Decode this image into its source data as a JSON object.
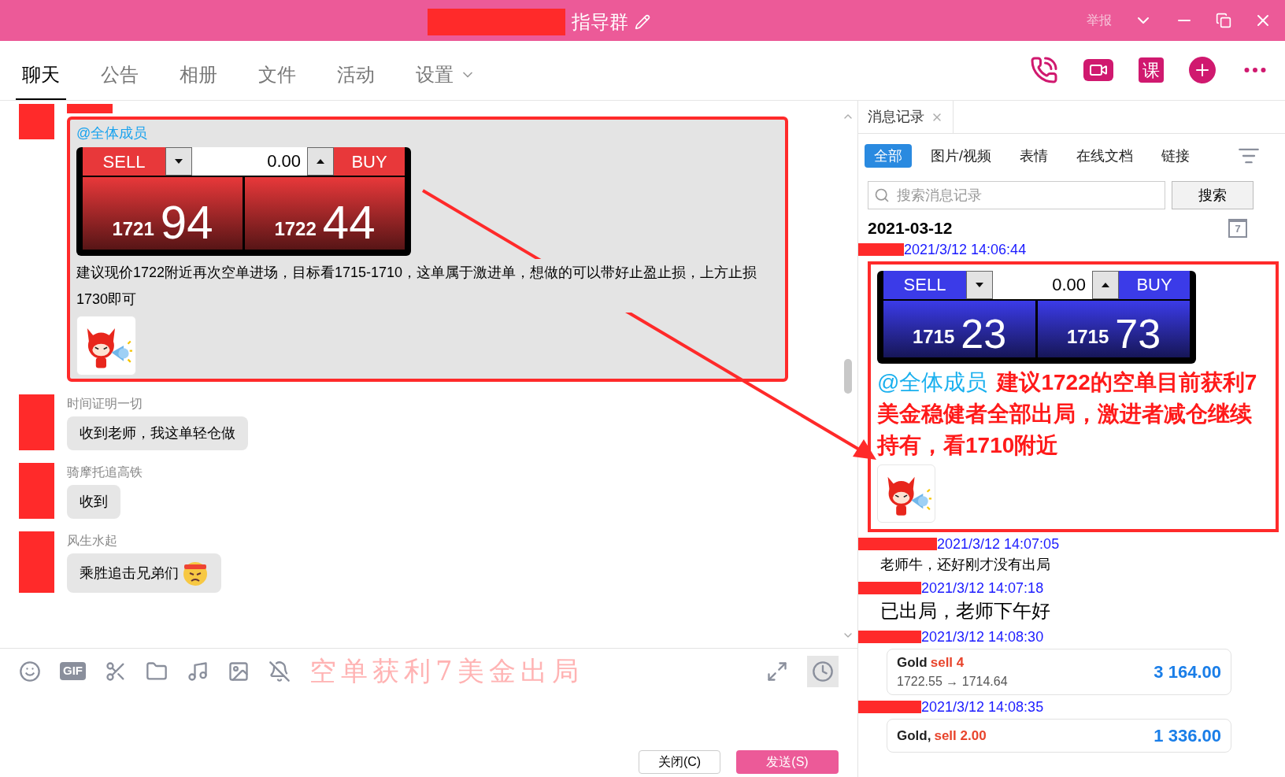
{
  "window": {
    "title": "指导群",
    "report": "举报"
  },
  "tabs": [
    {
      "label": "聊天",
      "selected": true,
      "dropdown": false
    },
    {
      "label": "公告",
      "selected": false,
      "dropdown": false
    },
    {
      "label": "相册",
      "selected": false,
      "dropdown": false
    },
    {
      "label": "文件",
      "selected": false,
      "dropdown": false
    },
    {
      "label": "活动",
      "selected": false,
      "dropdown": false
    },
    {
      "label": "设置",
      "selected": false,
      "dropdown": true
    }
  ],
  "toolbar": {
    "course_label": "课"
  },
  "chat": {
    "messages": [
      {
        "kind": "trade",
        "mention": "@全体成员",
        "widget": {
          "color": "#e8383a",
          "sell": "SELL",
          "lots": "0.00",
          "buy": "BUY",
          "bid_big": "1721",
          "bid_small": "94",
          "ask_big": "1722",
          "ask_small": "44"
        },
        "text": "建议现价1722附近再次空单进场，目标看1715-1710，这单属于激进单，想做的可以带好止盈止损，上方止损1730即可",
        "sticker": true,
        "highlighted": true
      },
      {
        "kind": "text",
        "sender": "时间证明一切",
        "text": "收到老师，我这单轻仓做",
        "emoji": false
      },
      {
        "kind": "text",
        "sender": "骑摩托追高铁",
        "text": "收到",
        "emoji": false
      },
      {
        "kind": "text",
        "sender": "风生水起",
        "text": "乘胜追击兄弟们",
        "emoji": true
      }
    ]
  },
  "composer": {
    "gif_label": "GIF",
    "overlay_caption": "空单获利7美金出局",
    "buttons": [
      {
        "label": "关闭(C)",
        "kind": "secondary"
      },
      {
        "label": "发送(S)",
        "kind": "primary"
      }
    ]
  },
  "history": {
    "tab": "消息记录",
    "filters": [
      {
        "label": "全部",
        "selected": true
      },
      {
        "label": "图片/视频",
        "selected": false
      },
      {
        "label": "表情",
        "selected": false
      },
      {
        "label": "在线文档",
        "selected": false
      },
      {
        "label": "链接",
        "selected": false
      }
    ],
    "search": {
      "placeholder": "搜索消息记录",
      "button": "搜索"
    },
    "date": "2021-03-12",
    "calendar_day": "7",
    "entries": [
      {
        "kind": "rich",
        "time": "2021/3/12 14:06:44",
        "widget": {
          "color": "#3b3be8",
          "sell": "SELL",
          "lots": "0.00",
          "buy": "BUY",
          "bid_big": "1715",
          "bid_small": "23",
          "ask_big": "1715",
          "ask_small": "73"
        },
        "mention": "@全体成员",
        "text": "建议1722的空单目前获利7美金稳健者全部出局，激进者减仓继续持有，看1710附近",
        "sticker": true,
        "highlighted": true
      },
      {
        "kind": "text",
        "time": "2021/3/12 14:07:05",
        "text": "老师牛，还好刚才没有出局",
        "large": false
      },
      {
        "kind": "text",
        "time": "2021/3/12 14:07:18",
        "text": "已出局，老师下午好",
        "large": true
      },
      {
        "kind": "trade_card",
        "time": "2021/3/12 14:08:30",
        "symbol": "Gold",
        "side": "sell 4",
        "prices": "1722.55 → 1714.64",
        "profit": "3 164.00"
      },
      {
        "kind": "trade_card",
        "time": "2021/3/12 14:08:35",
        "symbol": "Gold,",
        "side": "sell 2.00",
        "profit": "1 336.00"
      }
    ]
  }
}
